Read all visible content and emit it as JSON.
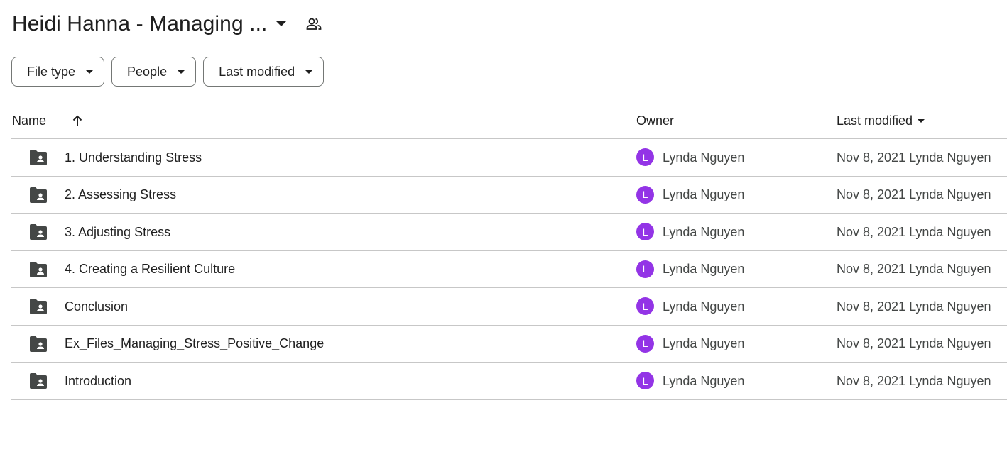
{
  "header": {
    "title": "Heidi Hanna - Managing ...",
    "caret_icon": "arrow-drop-down-icon",
    "shared_icon": "shared-people-icon"
  },
  "filters": [
    {
      "label": "File type"
    },
    {
      "label": "People"
    },
    {
      "label": "Last modified"
    }
  ],
  "columns": {
    "name": "Name",
    "owner": "Owner",
    "last_modified": "Last modified",
    "sort_icon": "arrow-upward-icon"
  },
  "files": [
    {
      "name": "1. Understanding Stress",
      "owner_initial": "L",
      "owner": "Lynda Nguyen",
      "modified": "Nov 8, 2021 Lynda Nguyen"
    },
    {
      "name": "2. Assessing Stress",
      "owner_initial": "L",
      "owner": "Lynda Nguyen",
      "modified": "Nov 8, 2021 Lynda Nguyen"
    },
    {
      "name": "3. Adjusting Stress",
      "owner_initial": "L",
      "owner": "Lynda Nguyen",
      "modified": "Nov 8, 2021 Lynda Nguyen"
    },
    {
      "name": "4. Creating a Resilient Culture",
      "owner_initial": "L",
      "owner": "Lynda Nguyen",
      "modified": "Nov 8, 2021 Lynda Nguyen"
    },
    {
      "name": "Conclusion",
      "owner_initial": "L",
      "owner": "Lynda Nguyen",
      "modified": "Nov 8, 2021 Lynda Nguyen"
    },
    {
      "name": "Ex_Files_Managing_Stress_Positive_Change",
      "owner_initial": "L",
      "owner": "Lynda Nguyen",
      "modified": "Nov 8, 2021 Lynda Nguyen"
    },
    {
      "name": "Introduction",
      "owner_initial": "L",
      "owner": "Lynda Nguyen",
      "modified": "Nov 8, 2021 Lynda Nguyen"
    }
  ],
  "colors": {
    "avatar": "#9334e6",
    "folder_icon": "#444746",
    "divider": "#c7c7c7"
  }
}
